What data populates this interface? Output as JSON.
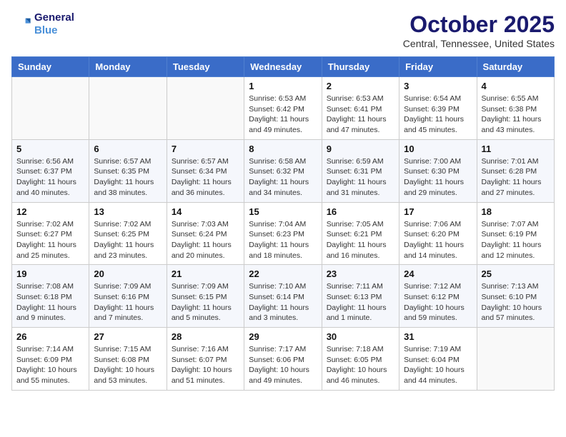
{
  "header": {
    "logo_line1": "General",
    "logo_line2": "Blue",
    "month": "October 2025",
    "location": "Central, Tennessee, United States"
  },
  "weekdays": [
    "Sunday",
    "Monday",
    "Tuesday",
    "Wednesday",
    "Thursday",
    "Friday",
    "Saturday"
  ],
  "weeks": [
    [
      {
        "day": "",
        "info": ""
      },
      {
        "day": "",
        "info": ""
      },
      {
        "day": "",
        "info": ""
      },
      {
        "day": "1",
        "info": "Sunrise: 6:53 AM\nSunset: 6:42 PM\nDaylight: 11 hours\nand 49 minutes."
      },
      {
        "day": "2",
        "info": "Sunrise: 6:53 AM\nSunset: 6:41 PM\nDaylight: 11 hours\nand 47 minutes."
      },
      {
        "day": "3",
        "info": "Sunrise: 6:54 AM\nSunset: 6:39 PM\nDaylight: 11 hours\nand 45 minutes."
      },
      {
        "day": "4",
        "info": "Sunrise: 6:55 AM\nSunset: 6:38 PM\nDaylight: 11 hours\nand 43 minutes."
      }
    ],
    [
      {
        "day": "5",
        "info": "Sunrise: 6:56 AM\nSunset: 6:37 PM\nDaylight: 11 hours\nand 40 minutes."
      },
      {
        "day": "6",
        "info": "Sunrise: 6:57 AM\nSunset: 6:35 PM\nDaylight: 11 hours\nand 38 minutes."
      },
      {
        "day": "7",
        "info": "Sunrise: 6:57 AM\nSunset: 6:34 PM\nDaylight: 11 hours\nand 36 minutes."
      },
      {
        "day": "8",
        "info": "Sunrise: 6:58 AM\nSunset: 6:32 PM\nDaylight: 11 hours\nand 34 minutes."
      },
      {
        "day": "9",
        "info": "Sunrise: 6:59 AM\nSunset: 6:31 PM\nDaylight: 11 hours\nand 31 minutes."
      },
      {
        "day": "10",
        "info": "Sunrise: 7:00 AM\nSunset: 6:30 PM\nDaylight: 11 hours\nand 29 minutes."
      },
      {
        "day": "11",
        "info": "Sunrise: 7:01 AM\nSunset: 6:28 PM\nDaylight: 11 hours\nand 27 minutes."
      }
    ],
    [
      {
        "day": "12",
        "info": "Sunrise: 7:02 AM\nSunset: 6:27 PM\nDaylight: 11 hours\nand 25 minutes."
      },
      {
        "day": "13",
        "info": "Sunrise: 7:02 AM\nSunset: 6:25 PM\nDaylight: 11 hours\nand 23 minutes."
      },
      {
        "day": "14",
        "info": "Sunrise: 7:03 AM\nSunset: 6:24 PM\nDaylight: 11 hours\nand 20 minutes."
      },
      {
        "day": "15",
        "info": "Sunrise: 7:04 AM\nSunset: 6:23 PM\nDaylight: 11 hours\nand 18 minutes."
      },
      {
        "day": "16",
        "info": "Sunrise: 7:05 AM\nSunset: 6:21 PM\nDaylight: 11 hours\nand 16 minutes."
      },
      {
        "day": "17",
        "info": "Sunrise: 7:06 AM\nSunset: 6:20 PM\nDaylight: 11 hours\nand 14 minutes."
      },
      {
        "day": "18",
        "info": "Sunrise: 7:07 AM\nSunset: 6:19 PM\nDaylight: 11 hours\nand 12 minutes."
      }
    ],
    [
      {
        "day": "19",
        "info": "Sunrise: 7:08 AM\nSunset: 6:18 PM\nDaylight: 11 hours\nand 9 minutes."
      },
      {
        "day": "20",
        "info": "Sunrise: 7:09 AM\nSunset: 6:16 PM\nDaylight: 11 hours\nand 7 minutes."
      },
      {
        "day": "21",
        "info": "Sunrise: 7:09 AM\nSunset: 6:15 PM\nDaylight: 11 hours\nand 5 minutes."
      },
      {
        "day": "22",
        "info": "Sunrise: 7:10 AM\nSunset: 6:14 PM\nDaylight: 11 hours\nand 3 minutes."
      },
      {
        "day": "23",
        "info": "Sunrise: 7:11 AM\nSunset: 6:13 PM\nDaylight: 11 hours\nand 1 minute."
      },
      {
        "day": "24",
        "info": "Sunrise: 7:12 AM\nSunset: 6:12 PM\nDaylight: 10 hours\nand 59 minutes."
      },
      {
        "day": "25",
        "info": "Sunrise: 7:13 AM\nSunset: 6:10 PM\nDaylight: 10 hours\nand 57 minutes."
      }
    ],
    [
      {
        "day": "26",
        "info": "Sunrise: 7:14 AM\nSunset: 6:09 PM\nDaylight: 10 hours\nand 55 minutes."
      },
      {
        "day": "27",
        "info": "Sunrise: 7:15 AM\nSunset: 6:08 PM\nDaylight: 10 hours\nand 53 minutes."
      },
      {
        "day": "28",
        "info": "Sunrise: 7:16 AM\nSunset: 6:07 PM\nDaylight: 10 hours\nand 51 minutes."
      },
      {
        "day": "29",
        "info": "Sunrise: 7:17 AM\nSunset: 6:06 PM\nDaylight: 10 hours\nand 49 minutes."
      },
      {
        "day": "30",
        "info": "Sunrise: 7:18 AM\nSunset: 6:05 PM\nDaylight: 10 hours\nand 46 minutes."
      },
      {
        "day": "31",
        "info": "Sunrise: 7:19 AM\nSunset: 6:04 PM\nDaylight: 10 hours\nand 44 minutes."
      },
      {
        "day": "",
        "info": ""
      }
    ]
  ]
}
